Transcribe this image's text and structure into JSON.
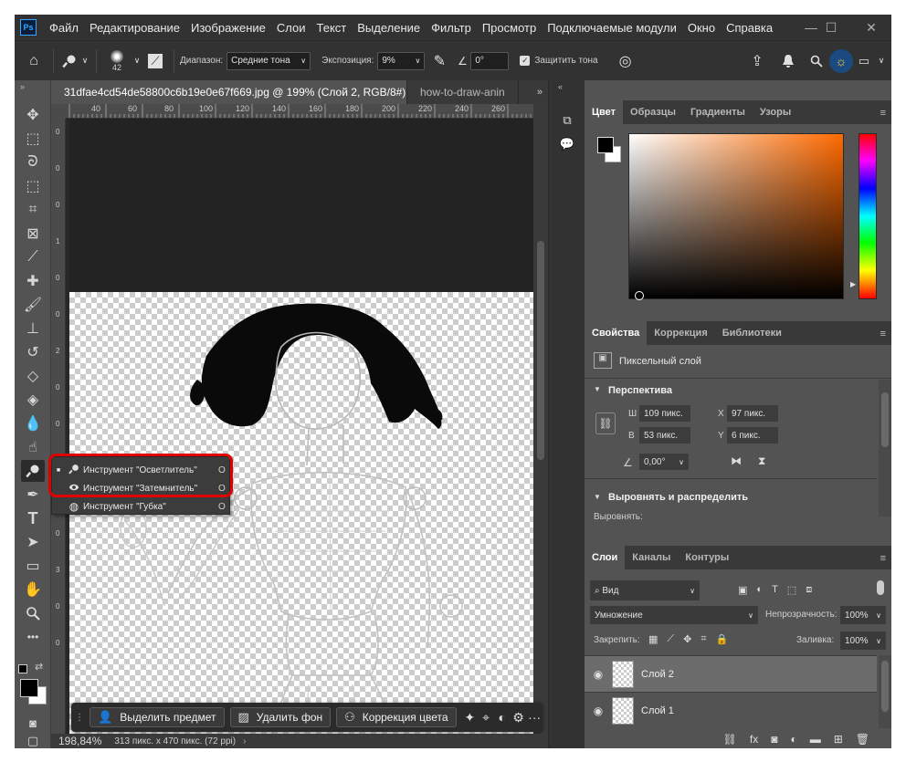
{
  "app": {
    "logo": "Ps"
  },
  "menu": [
    "Файл",
    "Редактирование",
    "Изображение",
    "Слои",
    "Текст",
    "Выделение",
    "Фильтр",
    "Просмотр",
    "Подключаемые модули",
    "Окно",
    "Справка"
  ],
  "window_controls": {
    "minimize": "—",
    "maximize": "☐",
    "close": "✕"
  },
  "options": {
    "brush_size": "42",
    "range_label": "Диапазон:",
    "range_value": "Средние тона",
    "exposure_label": "Экспозиция:",
    "exposure_value": "9%",
    "angle_value": "0°",
    "protect_label": "Защитить тона",
    "protect_checked": true
  },
  "tabs": [
    {
      "label": "31dfae4cd54de58800c6b19e0e67f669.jpg @ 199% (Слой 2, RGB/8#) *",
      "close": "×",
      "active": true
    },
    {
      "label": "how-to-draw-anin",
      "active": false
    }
  ],
  "tabs_overflow": "»",
  "ruler_h": [
    "40",
    "60",
    "80",
    "100",
    "120",
    "140",
    "160",
    "180",
    "200",
    "220",
    "240",
    "260"
  ],
  "ruler_v": [
    "0",
    "0",
    "0",
    "1",
    "0",
    "0",
    "2",
    "0",
    "0",
    "0",
    "2",
    "0",
    "3",
    "0",
    "0"
  ],
  "flyout": {
    "items": [
      {
        "label": "Инструмент \"Осветлитель\"",
        "key": "O",
        "icon": "dodge-icon",
        "active": true
      },
      {
        "label": "Инструмент \"Затемнитель\"",
        "key": "O",
        "icon": "burn-icon",
        "active": false
      },
      {
        "label": "Инструмент \"Губка\"",
        "key": "O",
        "icon": "sponge-icon",
        "active": false
      }
    ]
  },
  "highlight_color": "#e00000",
  "taskbar": {
    "select_subject": "Выделить предмет",
    "remove_bg": "Удалить фон",
    "color_correction": "Коррекция цвета",
    "more": "···"
  },
  "status": {
    "zoom": "198,84%",
    "info": "313 пикс. x 470 пикс. (72 ppi)"
  },
  "color_panel": {
    "tabs": [
      "Цвет",
      "Образцы",
      "Градиенты",
      "Узоры"
    ],
    "active_tab": "Цвет",
    "foreground": "#000000",
    "background": "#ffffff",
    "hue_color": "#ff6a00"
  },
  "properties_panel": {
    "tabs": [
      "Свойства",
      "Коррекция",
      "Библиотеки"
    ],
    "active_tab": "Свойства",
    "layer_type": "Пиксельный слой",
    "perspective_title": "Перспектива",
    "w_label": "Ш",
    "w_value": "109 пикс.",
    "h_label": "В",
    "h_value": "53 пикс.",
    "x_label": "X",
    "x_value": "97 пикс.",
    "y_label": "Y",
    "y_value": "6 пикс.",
    "angle_value": "0,00°",
    "align_title": "Выровнять и распределить",
    "align_label": "Выровнять:"
  },
  "layers_panel": {
    "tabs": [
      "Слои",
      "Каналы",
      "Контуры"
    ],
    "active_tab": "Слои",
    "filter_value": "Вид",
    "blend_mode": "Умножение",
    "opacity_label": "Непрозрачность:",
    "opacity_value": "100%",
    "lock_label": "Закрепить:",
    "fill_label": "Заливка:",
    "fill_value": "100%",
    "layers": [
      {
        "name": "Слой 2",
        "selected": true
      },
      {
        "name": "Слой 1",
        "selected": false
      }
    ]
  }
}
